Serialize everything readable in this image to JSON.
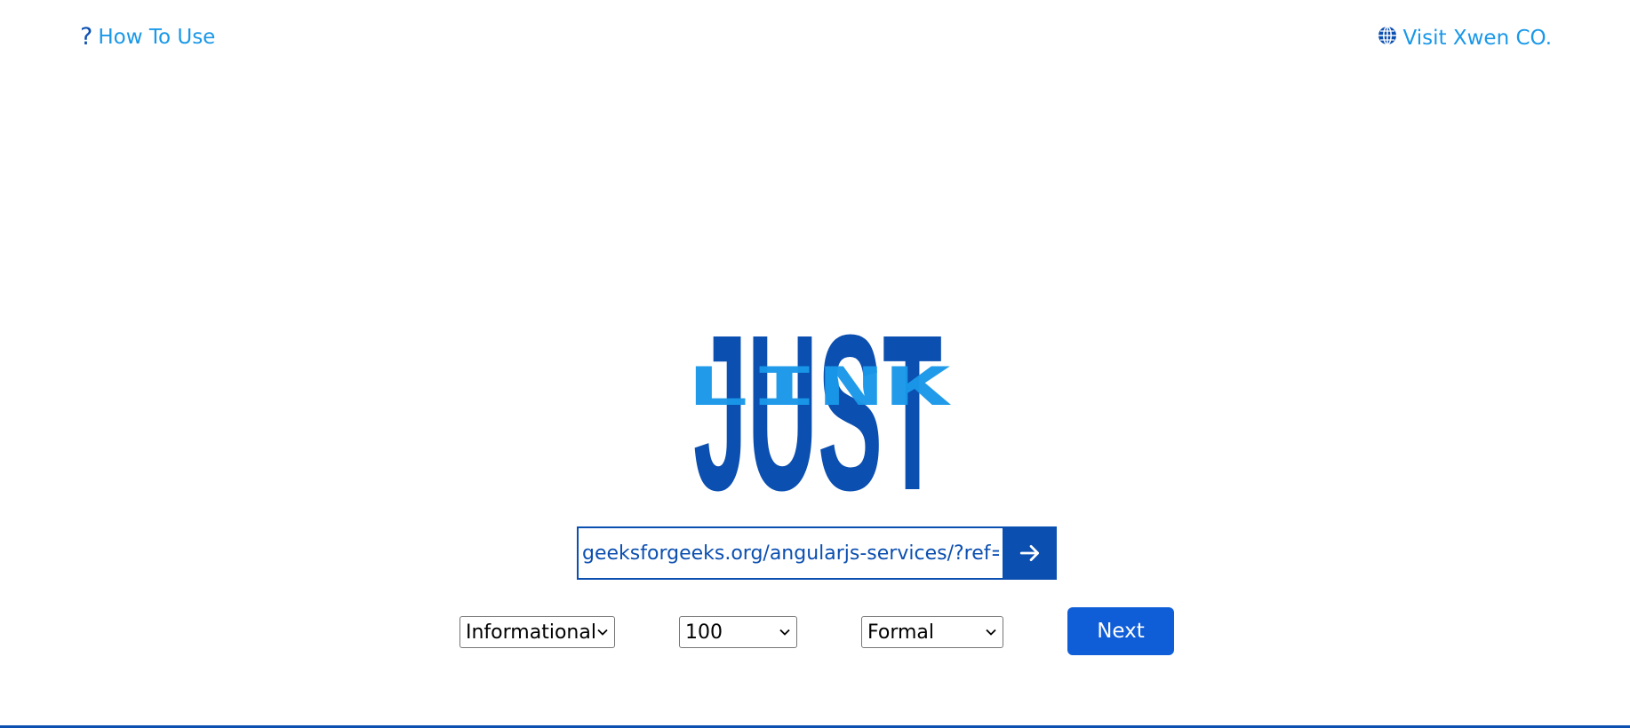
{
  "nav": {
    "how_to_use": "How To Use",
    "visit": "Visit Xwen CO."
  },
  "logo": {
    "word_main": "JUST",
    "word_overlay": "LINK"
  },
  "url_form": {
    "value": "geeksforgeeks.org/angularjs-services/?ref=",
    "submit_icon": "arrow-right-icon"
  },
  "controls": {
    "type_selected": "Informational",
    "count_selected": "100",
    "tone_selected": "Formal",
    "next_label": "Next"
  },
  "colors": {
    "primary": "#0b4fb0",
    "accent": "#1a98e8",
    "button": "#0f5ed7"
  }
}
